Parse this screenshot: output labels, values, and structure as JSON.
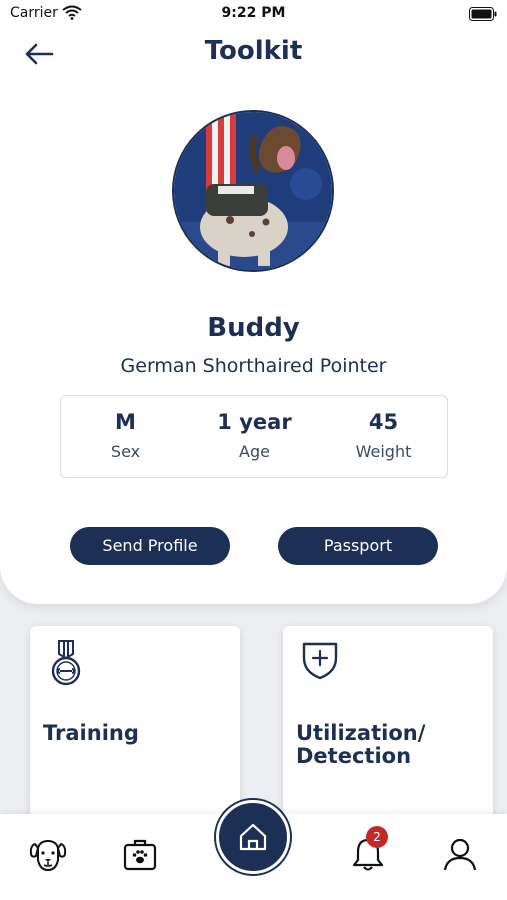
{
  "status_bar": {
    "carrier": "Carrier",
    "time": "9:22 PM"
  },
  "header": {
    "title": "Toolkit",
    "back_icon": "arrow-left-icon"
  },
  "profile": {
    "name": "Buddy",
    "breed": "German Shorthaired Pointer",
    "stats": [
      {
        "value": "M",
        "label": "Sex"
      },
      {
        "value": "1 year",
        "label": "Age"
      },
      {
        "value": "45",
        "label": "Weight"
      }
    ],
    "actions": {
      "send_profile": "Send Profile",
      "passport": "Passport"
    }
  },
  "tiles": [
    {
      "label": "Training",
      "icon": "medal-icon"
    },
    {
      "label": "Utilization/\nDetection",
      "icon": "shield-plus-icon"
    }
  ],
  "bottom_nav": {
    "items": [
      "dog-icon",
      "vet-kit-icon",
      "home-icon",
      "bell-icon",
      "user-icon"
    ],
    "notification_count": "2"
  },
  "colors": {
    "primary": "#1c2f55",
    "badge": "#c62828",
    "background": "#eceef2"
  }
}
